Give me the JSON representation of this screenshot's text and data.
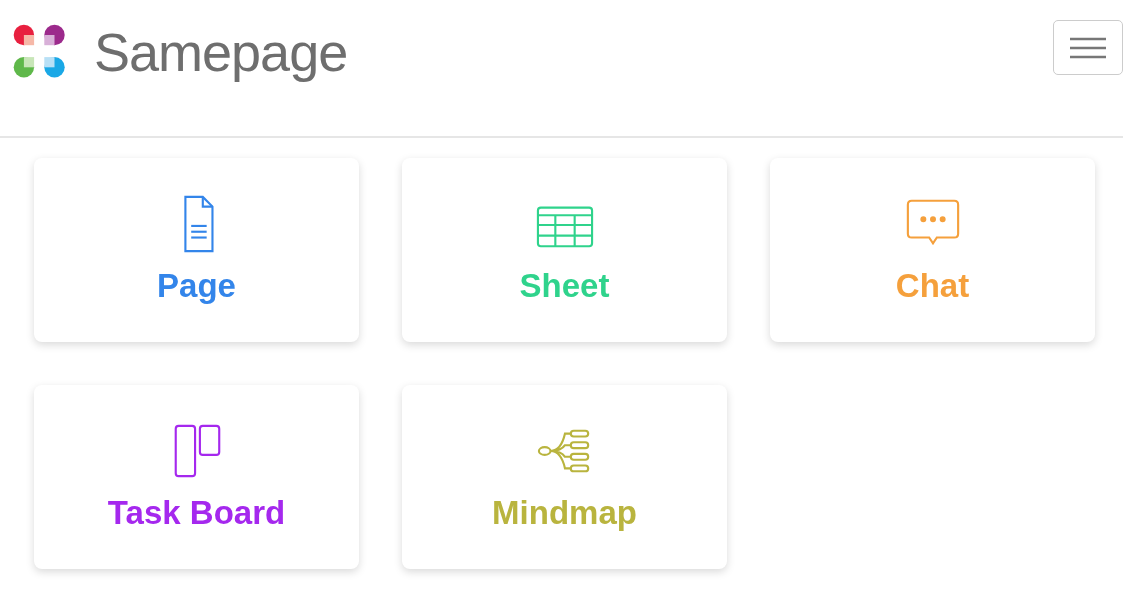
{
  "header": {
    "brand": "Samepage"
  },
  "cards": [
    {
      "kind": "page",
      "label": "Page",
      "color": "#3385ea"
    },
    {
      "kind": "sheet",
      "label": "Sheet",
      "color": "#2fd38c"
    },
    {
      "kind": "chat",
      "label": "Chat",
      "color": "#f5a03c"
    },
    {
      "kind": "board",
      "label": "Task Board",
      "color": "#a528ee"
    },
    {
      "kind": "mindmap",
      "label": "Mindmap",
      "color": "#b9b43e"
    }
  ]
}
